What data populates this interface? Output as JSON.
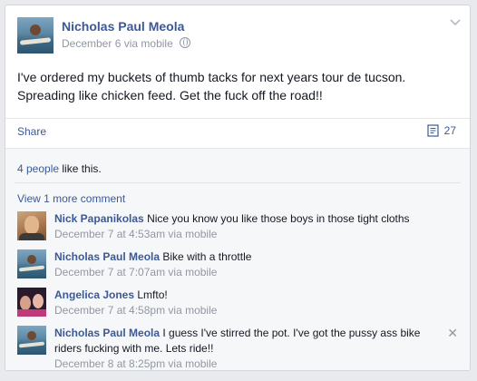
{
  "post": {
    "author": "Nicholas Paul Meola",
    "date": "December 6",
    "via": "via mobile",
    "text": "I've ordered my buckets of thumb tacks for next years tour de tucson. Spreading like chicken feed. Get the fuck off the road!!"
  },
  "actions": {
    "share_label": "Share",
    "comment_count": "27"
  },
  "likes": {
    "link_text": "4 people",
    "suffix": " like this."
  },
  "view_more": "View 1 more comment",
  "comments": [
    {
      "author": "Nick Papanikolas",
      "text": "Nice you know you like those boys in those tight cloths",
      "time": "December 7 at 4:53am via mobile"
    },
    {
      "author": "Nicholas Paul Meola",
      "text": "Bike with a throttle",
      "time": "December 7 at 7:07am via mobile"
    },
    {
      "author": "Angelica Jones",
      "text": "Lmfto!",
      "time": "December 7 at 4:58pm via mobile"
    },
    {
      "author": "Nicholas Paul Meola",
      "text": "I guess I've stirred the pot. I've got the pussy ass bike riders fucking with me. Lets ride!!",
      "time": "December 8 at 8:25pm via mobile"
    }
  ],
  "colors": {
    "link": "#3b5998",
    "meta": "#9197a3",
    "background": "#e9eaed",
    "ufi_background": "#f6f7f8"
  }
}
